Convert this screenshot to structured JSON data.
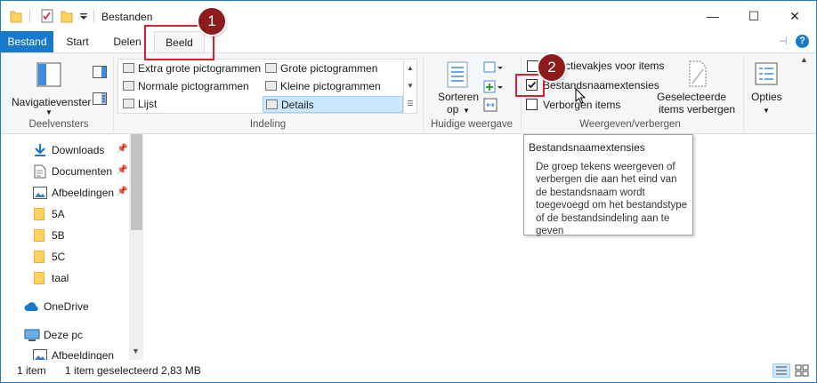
{
  "window": {
    "title": "Bestanden",
    "minimize_glyph": "—",
    "maximize_glyph": "☐",
    "close_glyph": "✕"
  },
  "tabs": {
    "file": "Bestand",
    "home": "Start",
    "share": "Delen",
    "view": "Beeld"
  },
  "ribbon": {
    "panes": {
      "nav_pane_label": "Navigatievenster",
      "group_label": "Deelvensters"
    },
    "layout": {
      "group_label": "Indeling",
      "items": [
        "Extra grote pictogrammen",
        "Grote pictogrammen",
        "Normale pictogrammen",
        "Kleine pictogrammen",
        "Lijst",
        "Details"
      ],
      "selected": "Details"
    },
    "current_view": {
      "sort_line1": "Sorteren",
      "sort_line2": "op",
      "group_label": "Huidige weergave"
    },
    "show_hide": {
      "checkbox_item": "Selectievakjes voor items",
      "checkbox_item_visible": "ctievakjes voor items",
      "file_ext": "Bestandsnaamextensies",
      "file_ext_checked": true,
      "hidden_items": "Verborgen items",
      "hide_selected_line1": "Geselecteerde",
      "hide_selected_line2": "items verbergen",
      "group_label": "Weergeven/verbergen"
    },
    "options": {
      "label": "Opties"
    }
  },
  "nav_pane": {
    "items": [
      {
        "label": "Downloads",
        "icon": "download-icon",
        "pinned": true
      },
      {
        "label": "Documenten",
        "icon": "document-icon",
        "pinned": true
      },
      {
        "label": "Afbeeldingen",
        "icon": "pictures-icon",
        "pinned": true
      },
      {
        "label": "5A",
        "icon": "folder-icon",
        "pinned": false
      },
      {
        "label": "5B",
        "icon": "folder-icon",
        "pinned": false
      },
      {
        "label": "5C",
        "icon": "folder-icon",
        "pinned": false
      },
      {
        "label": "taal",
        "icon": "folder-icon",
        "pinned": false
      },
      {
        "label": "OneDrive",
        "icon": "cloud-icon",
        "pinned": false
      },
      {
        "label": "Deze pc",
        "icon": "computer-icon",
        "pinned": false
      },
      {
        "label": "Afbeeldingen",
        "icon": "pictures-icon",
        "pinned": false
      }
    ]
  },
  "status": {
    "count": "1 item",
    "selection": "1 item geselecteerd  2,83 MB"
  },
  "tooltip": {
    "title": "Bestandsnaamextensies",
    "body": "De groep tekens weergeven of verbergen die aan het eind van de bestandsnaam wordt toegevoegd om het bestandstype of de bestandsindeling aan te geven"
  },
  "annotations": {
    "step1": "1",
    "step2": "2",
    "color": "#d9202b",
    "badge_color": "#8e1b1b"
  },
  "colors": {
    "accent": "#1979ca",
    "ribbon_bg": "#f5f6f7",
    "selection": "#cce8ff"
  }
}
